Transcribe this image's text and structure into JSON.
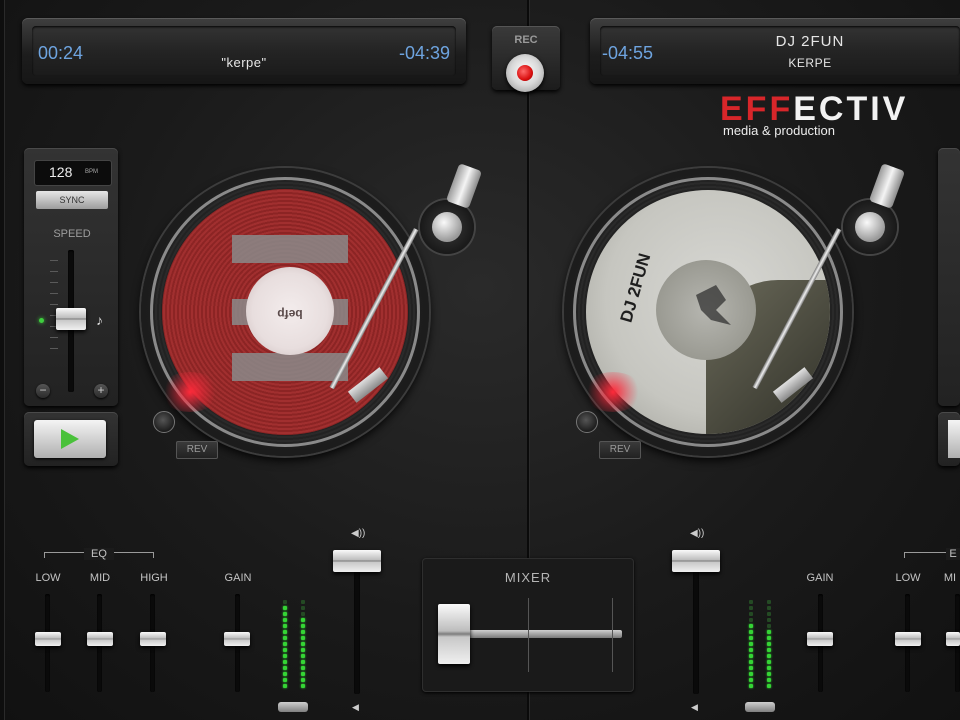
{
  "deck_left": {
    "elapsed": "00:24",
    "track": "\"kerpe\"",
    "remaining": "-04:39",
    "bpm": "128",
    "bpm_unit": "BPM",
    "sync_label": "SYNC",
    "speed_label": "SPEED",
    "speed_minus": "−",
    "speed_plus": "+",
    "rev_label": "REV",
    "record_color": "#9b2a2a",
    "record_label_text": "befp"
  },
  "deck_right": {
    "remaining": "-04:55",
    "artist": "DJ 2FUN",
    "track": "KERPE",
    "rev_label": "REV",
    "record_label_text": "DJ 2FUN"
  },
  "rec": {
    "label": "REC"
  },
  "logo": {
    "red_part": "EFF",
    "white_part": "ECTIV",
    "subtitle": "media & production"
  },
  "mixer": {
    "title": "MIXER",
    "eq_label": "EQ",
    "low_label": "LOW",
    "mid_label": "MID",
    "high_label": "HIGH",
    "gain_label": "GAIN",
    "right_gain_label": "GAIN",
    "right_low_label": "LOW",
    "right_mid_label": "MI",
    "right_eq_label": "E",
    "crossfader_position": 0.05
  },
  "colors": {
    "accent_red": "#d8262a",
    "time_blue": "#6ea4e0",
    "led_green": "#3fcf3f"
  }
}
